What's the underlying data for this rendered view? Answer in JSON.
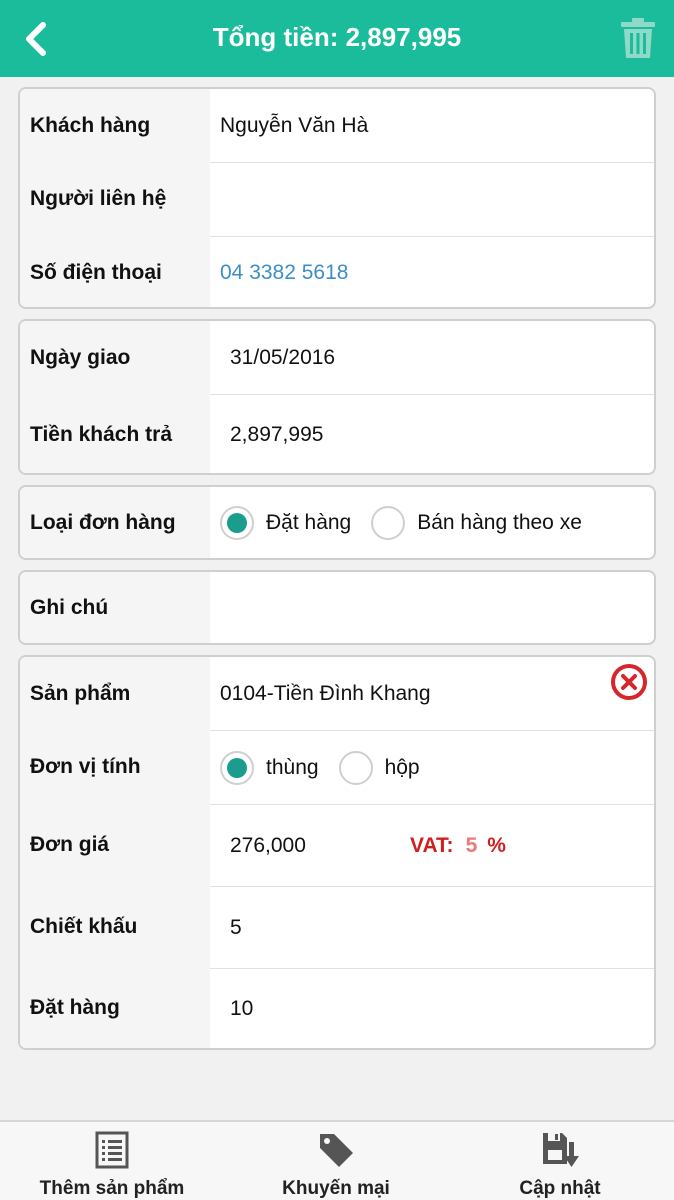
{
  "header": {
    "title": "Tổng tiền: 2,897,995"
  },
  "customer": {
    "name_label": "Khách hàng",
    "name_value": "Nguyễn Văn Hà",
    "contact_label": "Người liên hệ",
    "contact_value": "",
    "phone_label": "Số điện thoại",
    "phone_value": "04 3382 5618"
  },
  "delivery": {
    "date_label": "Ngày giao",
    "date_value": "31/05/2016",
    "paid_label": "Tiền khách trả",
    "paid_value": "2,897,995"
  },
  "order_type": {
    "label": "Loại đơn hàng",
    "options": [
      {
        "label": "Đặt hàng",
        "selected": true
      },
      {
        "label": "Bán hàng theo xe",
        "selected": false
      }
    ]
  },
  "note": {
    "label": "Ghi chú",
    "value": ""
  },
  "product": {
    "product_label": "Sản phẩm",
    "product_value": "0104-Tiền Đình Khang",
    "unit_label": "Đơn vị tính",
    "unit_options": [
      {
        "label": "thùng",
        "selected": true
      },
      {
        "label": "hộp",
        "selected": false
      }
    ],
    "price_label": "Đơn giá",
    "price_value": "276,000",
    "vat_label": "VAT:",
    "vat_value": "5",
    "vat_unit": "%",
    "discount_label": "Chiết khấu",
    "discount_value": "5",
    "qty_label": "Đặt hàng",
    "qty_value": "10"
  },
  "bottom_bar": {
    "add_product": "Thêm sản phẩm",
    "promotion": "Khuyến mại",
    "update": "Cập nhật"
  },
  "colors": {
    "accent": "#1bbc9b",
    "radio_selected": "#1a9d8d",
    "vat_red": "#d11f1f",
    "phone_link": "#3b8fc7"
  }
}
